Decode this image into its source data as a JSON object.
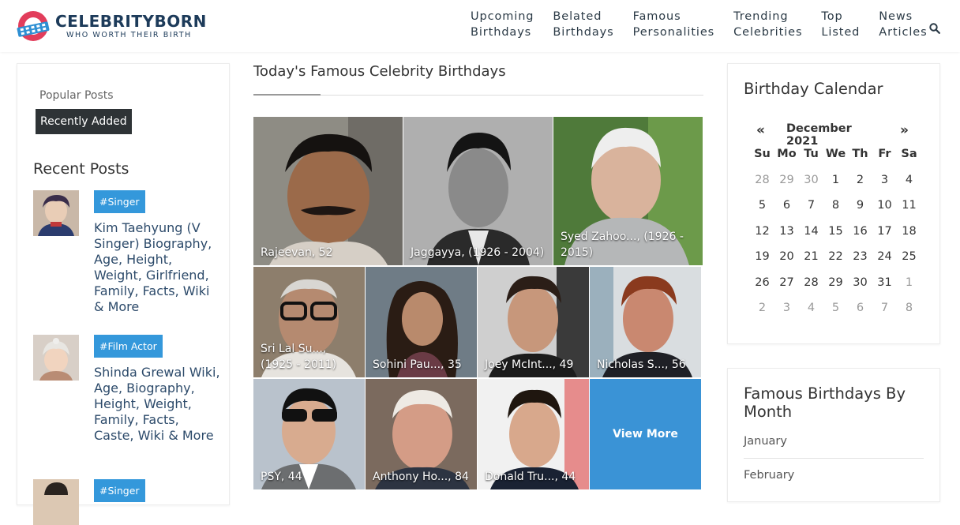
{
  "header": {
    "logo_name_celebrity": "CELEBRITY",
    "logo_name_born": "BORN",
    "logo_tagline": "WHO WORTH THEIR BIRTH",
    "nav": [
      {
        "line1": "Upcoming",
        "line2": "Birthdays"
      },
      {
        "line1": "Belated",
        "line2": "Birthdays"
      },
      {
        "line1": "Famous",
        "line2": "Personalities"
      },
      {
        "line1": "Trending",
        "line2": "Celebrities"
      },
      {
        "line1": "Top",
        "line2": "Listed"
      },
      {
        "line1": "News",
        "line2": "Articles"
      }
    ],
    "search_icon": "search-icon"
  },
  "sidebar": {
    "tab_popular": "Popular Posts",
    "tab_recent": "Recently Added",
    "recent_title": "Recent Posts",
    "posts": [
      {
        "tag": "#Singer",
        "title": "Kim Taehyung (V Singer) Biography, Age, Height, Weight, Girlfriend, Family, Facts, Wiki & More"
      },
      {
        "tag": "#Film Actor",
        "title": "Shinda Grewal Wiki, Age, Biography, Height, Weight, Family, Facts, Caste, Wiki & More"
      },
      {
        "tag": "#Singer",
        "title": ""
      }
    ]
  },
  "main": {
    "title": "Today's Famous Celebrity Birthdays",
    "tiles": [
      {
        "caption": "Rajeevan, 52"
      },
      {
        "caption": "Jaggayya, (1926 - 2004)"
      },
      {
        "caption": "Syed Zahoo..., (1926 - 2015)"
      },
      {
        "caption": "Sri Lal Su..., (1925 - 2011)"
      },
      {
        "caption": "Sohini Pau..., 35"
      },
      {
        "caption": "Joey McInt..., 49"
      },
      {
        "caption": "Nicholas S..., 56"
      },
      {
        "caption": "PSY, 44"
      },
      {
        "caption": "Anthony Ho..., 84"
      },
      {
        "caption": "Donald Tru..., 44"
      }
    ],
    "view_more": "View More"
  },
  "calendar": {
    "title": "Birthday Calendar",
    "prev": "«",
    "next": "»",
    "month": "December 2021",
    "weekdays": [
      "Su",
      "Mo",
      "Tu",
      "We",
      "Th",
      "Fr",
      "Sa"
    ],
    "weeks": [
      [
        "28",
        "29",
        "30",
        "1",
        "2",
        "3",
        "4"
      ],
      [
        "5",
        "6",
        "7",
        "8",
        "9",
        "10",
        "11"
      ],
      [
        "12",
        "13",
        "14",
        "15",
        "16",
        "17",
        "18"
      ],
      [
        "19",
        "20",
        "21",
        "22",
        "23",
        "24",
        "25"
      ],
      [
        "26",
        "27",
        "28",
        "29",
        "30",
        "31",
        "1"
      ],
      [
        "2",
        "3",
        "4",
        "5",
        "6",
        "7",
        "8"
      ]
    ]
  },
  "months_card": {
    "title": "Famous Birthdays By Month",
    "items": [
      "January",
      "February"
    ]
  },
  "colors": {
    "accent": "#3498db",
    "view_more_bg": "#3a93d6",
    "dark_tab": "#2e3336",
    "link": "#2c4a6a"
  }
}
